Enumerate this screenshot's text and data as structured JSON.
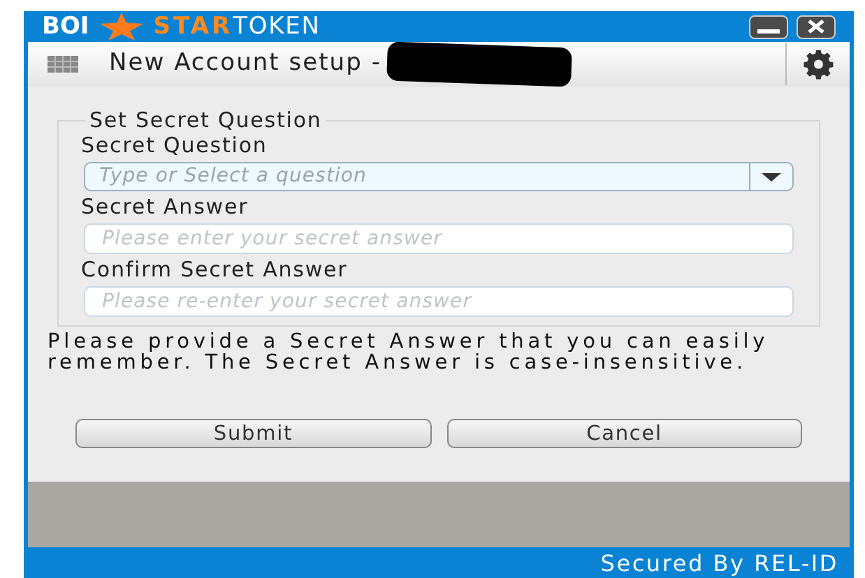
{
  "logo": {
    "bank": "BOI",
    "star": "STAR",
    "token": "TOKEN"
  },
  "header": {
    "title": "New Account setup -"
  },
  "form": {
    "legend": "Set Secret Question",
    "fields": [
      {
        "kind": "combo",
        "label": "Secret Question",
        "placeholder": "Type or Select a question",
        "focused": true
      },
      {
        "kind": "text",
        "label": "Secret Answer",
        "placeholder": "Please enter your secret answer",
        "focused": false
      },
      {
        "kind": "text",
        "label": "Confirm Secret Answer",
        "placeholder": "Please re-enter your secret answer",
        "focused": false
      }
    ]
  },
  "help_text": "Please provide a Secret Answer that you can easily remember. The Secret Answer is case-insensitive.",
  "buttons": [
    "Submit",
    "Cancel"
  ],
  "footer": "Secured By REL-ID"
}
